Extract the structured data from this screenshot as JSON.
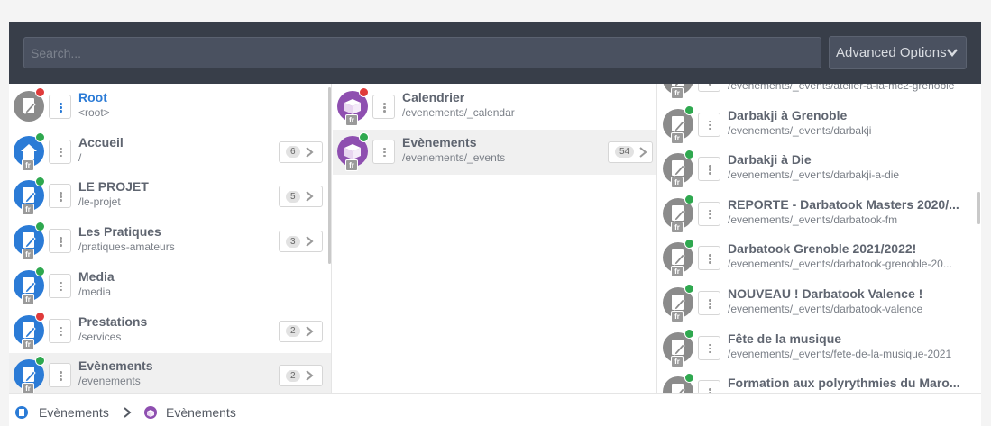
{
  "search": {
    "placeholder": "Search..."
  },
  "advanced": {
    "label": "Advanced Options"
  },
  "colors": {
    "topbar": "#383e49",
    "blue": "#2b7bd6",
    "purple": "#8e4fb0",
    "gray": "#8b8b8b",
    "green": "#2fa84f",
    "red": "#e03b3b"
  },
  "column1": [
    {
      "title": "Root",
      "path": "<root>",
      "icon": "page-icon",
      "status": "red",
      "lang": ""
    },
    {
      "title": "Accueil",
      "path": "/",
      "icon": "home-icon",
      "status": "green",
      "lang": "fr",
      "count": "6"
    },
    {
      "title": "LE PROJET",
      "path": "/le-projet",
      "icon": "page-icon",
      "status": "green",
      "lang": "fr",
      "count": "5"
    },
    {
      "title": "Les Pratiques",
      "path": "/pratiques-amateurs",
      "icon": "page-icon",
      "status": "green",
      "lang": "fr",
      "count": "3"
    },
    {
      "title": "Media",
      "path": "/media",
      "icon": "page-icon",
      "status": "green",
      "lang": "fr"
    },
    {
      "title": "Prestations",
      "path": "/services",
      "icon": "page-icon",
      "status": "red",
      "lang": "fr",
      "count": "2"
    },
    {
      "title": "Evènements",
      "path": "/evenements",
      "icon": "page-icon",
      "status": "green",
      "lang": "fr",
      "count": "2"
    }
  ],
  "column2": [
    {
      "title": "Calendrier",
      "path": "/evenements/_calendar",
      "icon": "module-icon",
      "status": "red",
      "lang": "fr"
    },
    {
      "title": "Evènements",
      "path": "/evenements/_events",
      "icon": "module-icon",
      "status": "green",
      "lang": "fr",
      "count": "54"
    }
  ],
  "column3": [
    {
      "title": "",
      "path": "/evenements/_events/atelier-a-la-mc2-grenoble",
      "icon": "page-icon",
      "status": "green",
      "lang": "fr"
    },
    {
      "title": "Darbakji à Grenoble",
      "path": "/evenements/_events/darbakji",
      "icon": "page-icon",
      "status": "green",
      "lang": "fr"
    },
    {
      "title": "Darbakji à Die",
      "path": "/evenements/_events/darbakji-a-die",
      "icon": "page-icon",
      "status": "green",
      "lang": "fr"
    },
    {
      "title": "REPORTE - Darbatook Masters 2020/...",
      "path": "/evenements/_events/darbatook-fm",
      "icon": "page-icon",
      "status": "green",
      "lang": "fr"
    },
    {
      "title": "Darbatook Grenoble 2021/2022!",
      "path": "/evenements/_events/darbatook-grenoble-20...",
      "icon": "page-icon",
      "status": "green",
      "lang": "fr"
    },
    {
      "title": "NOUVEAU ! Darbatook Valence !",
      "path": "/evenements/_events/darbatook-valence",
      "icon": "page-icon",
      "status": "green",
      "lang": "fr"
    },
    {
      "title": "Fête de la musique",
      "path": "/evenements/_events/fete-de-la-musique-2021",
      "icon": "page-icon",
      "status": "green",
      "lang": "fr"
    },
    {
      "title": "Formation aux polyrythmies du Maro...",
      "path": "",
      "icon": "page-icon",
      "status": "green",
      "lang": "fr"
    }
  ],
  "breadcrumb": [
    {
      "label": "Evènements",
      "icon": "page-icon"
    },
    {
      "label": "Evènements",
      "icon": "module-icon"
    }
  ]
}
